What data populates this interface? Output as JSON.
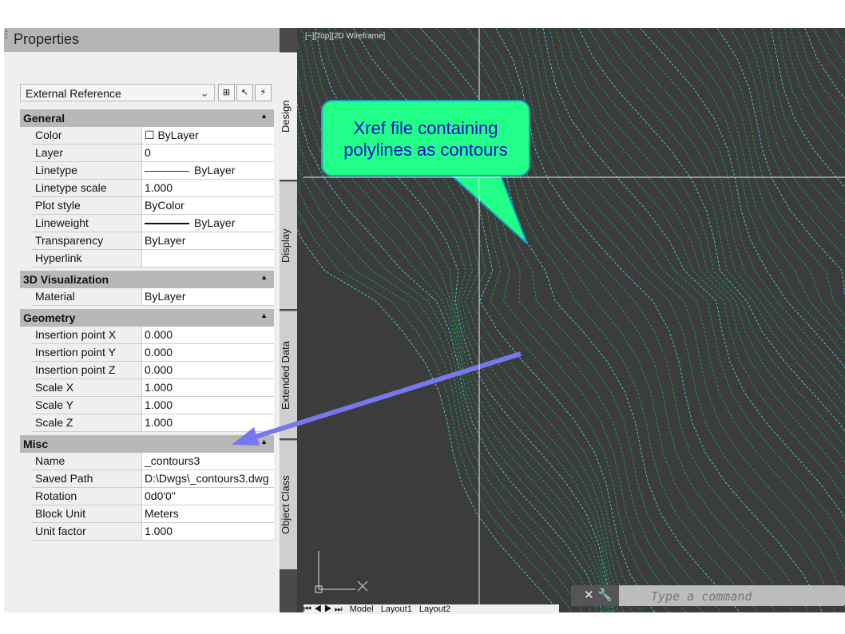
{
  "panel": {
    "title": "Properties",
    "selector": "External Reference",
    "tools": [
      "quick-select-icon",
      "select-objects-icon",
      "toggle-pickadd-icon"
    ]
  },
  "sections": [
    {
      "title": "General",
      "rows": [
        [
          "Color",
          "☐ ByLayer"
        ],
        [
          "Layer",
          "0"
        ],
        [
          "Linetype",
          "ByLayer"
        ],
        [
          "Linetype scale",
          "1.000"
        ],
        [
          "Plot style",
          "ByColor"
        ],
        [
          "Lineweight",
          "ByLayer"
        ],
        [
          "Transparency",
          "ByLayer"
        ],
        [
          "Hyperlink",
          ""
        ]
      ]
    },
    {
      "title": "3D Visualization",
      "rows": [
        [
          "Material",
          "ByLayer"
        ]
      ]
    },
    {
      "title": "Geometry",
      "rows": [
        [
          "Insertion point X",
          "0.000"
        ],
        [
          "Insertion point Y",
          "0.000"
        ],
        [
          "Insertion point Z",
          "0.000"
        ],
        [
          "Scale X",
          "1.000"
        ],
        [
          "Scale Y",
          "1.000"
        ],
        [
          "Scale Z",
          "1.000"
        ]
      ]
    },
    {
      "title": "Misc",
      "rows": [
        [
          "Name",
          "_contours3"
        ],
        [
          "Saved Path",
          "D:\\Dwgs\\_contours3.dwg"
        ],
        [
          "Rotation",
          "0d0'0\""
        ],
        [
          "Block Unit",
          "Meters"
        ],
        [
          "Unit factor",
          "1.000"
        ]
      ]
    }
  ],
  "side_tabs": [
    "Design",
    "Display",
    "Extended Data",
    "Object Class"
  ],
  "viewport": {
    "label": "[−][Top][2D Wireframe]",
    "callout": "Xref file containing polylines as contours",
    "colors": {
      "contour_cyan": "#3cc8d0",
      "contour_green": "#1a9a5a",
      "callout_fill": "#22ff88",
      "arrow": "#7777ee"
    }
  },
  "layout_tabs": [
    "Model",
    "Layout1",
    "Layout2"
  ],
  "command": {
    "placeholder": "Type a command"
  }
}
